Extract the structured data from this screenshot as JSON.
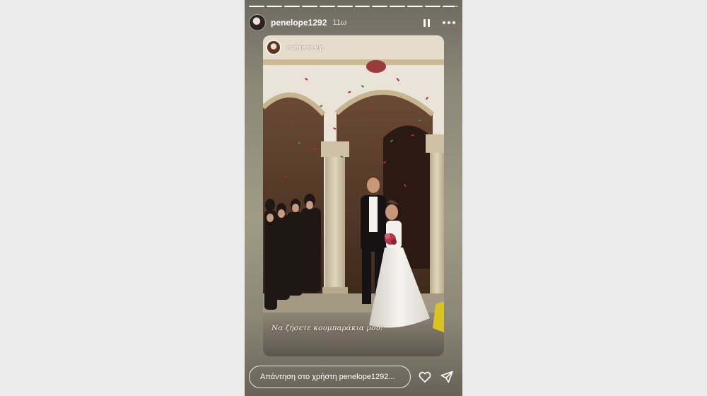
{
  "story": {
    "progress_segments": [
      1,
      1,
      1,
      1,
      1,
      1,
      1,
      1,
      1,
      1,
      1,
      0.75
    ],
    "author": {
      "username": "penelope1292",
      "time_ago": "11ω"
    },
    "repost": {
      "username": "marilena.elp"
    },
    "caption": "Να ζήσετε κουμπαράκια μου!",
    "reply": {
      "placeholder": "Απάντηση στο χρήστη penelope1292..."
    }
  },
  "icons": {
    "pause": "pause-icon",
    "more": "more-icon",
    "like": "heart-icon",
    "share": "send-icon"
  },
  "colors": {
    "stage_background": "#9a9480",
    "text": "#ffffff",
    "page_background": "#ececec"
  }
}
